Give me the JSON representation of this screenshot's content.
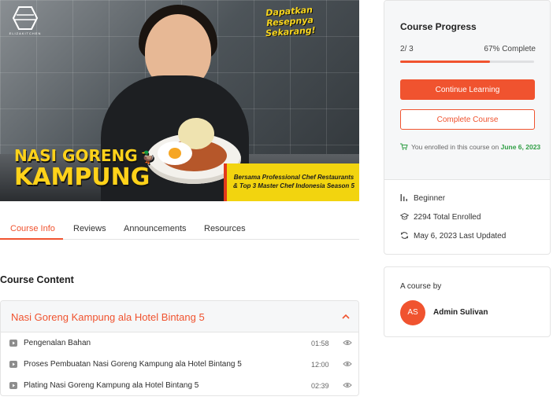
{
  "hero": {
    "logo_text": "ELIZAKITCHEN",
    "promo_text": "Dapatkan Resepnya Sekarang!",
    "title_line1": "NASI GORENG",
    "title_line2": "KAMPUNG",
    "banner_text": "Bersama Professional Chef Restaurants & Top 3 Master Chef Indonesia Season 5"
  },
  "tabs": [
    {
      "label": "Course Info",
      "active": true
    },
    {
      "label": "Reviews",
      "active": false
    },
    {
      "label": "Announcements",
      "active": false
    },
    {
      "label": "Resources",
      "active": false
    }
  ],
  "course_content": {
    "heading": "Course Content",
    "topic": {
      "title": "Nasi Goreng Kampung ala Hotel Bintang 5",
      "expanded": true,
      "lessons": [
        {
          "title": "Pengenalan Bahan",
          "duration": "01:58"
        },
        {
          "title": "Proses Pembuatan Nasi Goreng Kampung ala Hotel Bintang 5",
          "duration": "12:00"
        },
        {
          "title": "Plating Nasi Goreng Kampung ala Hotel Bintang 5",
          "duration": "02:39"
        }
      ]
    }
  },
  "progress": {
    "title": "Course Progress",
    "count_text": "2/ 3",
    "percent_text": "67% Complete",
    "percent_value": 67,
    "continue_label": "Continue Learning",
    "complete_label": "Complete Course",
    "enroll_note": "You enrolled in this course on",
    "enroll_date": "June 6, 2023"
  },
  "meta": {
    "level": "Beginner",
    "enrolled": "2294 Total Enrolled",
    "updated": "May 6, 2023 Last Updated"
  },
  "author": {
    "label": "A course by",
    "initials": "AS",
    "name": "Admin Sulivan"
  },
  "colors": {
    "accent": "#f0532f",
    "success": "#2f9e44",
    "hero_yellow": "#ffd21a"
  },
  "icons": [
    "hexagon-logo-icon",
    "duck-icon",
    "chevron-up-icon",
    "play-icon",
    "eye-icon",
    "cart-icon",
    "level-bars-icon",
    "graduation-cap-icon",
    "refresh-icon"
  ]
}
